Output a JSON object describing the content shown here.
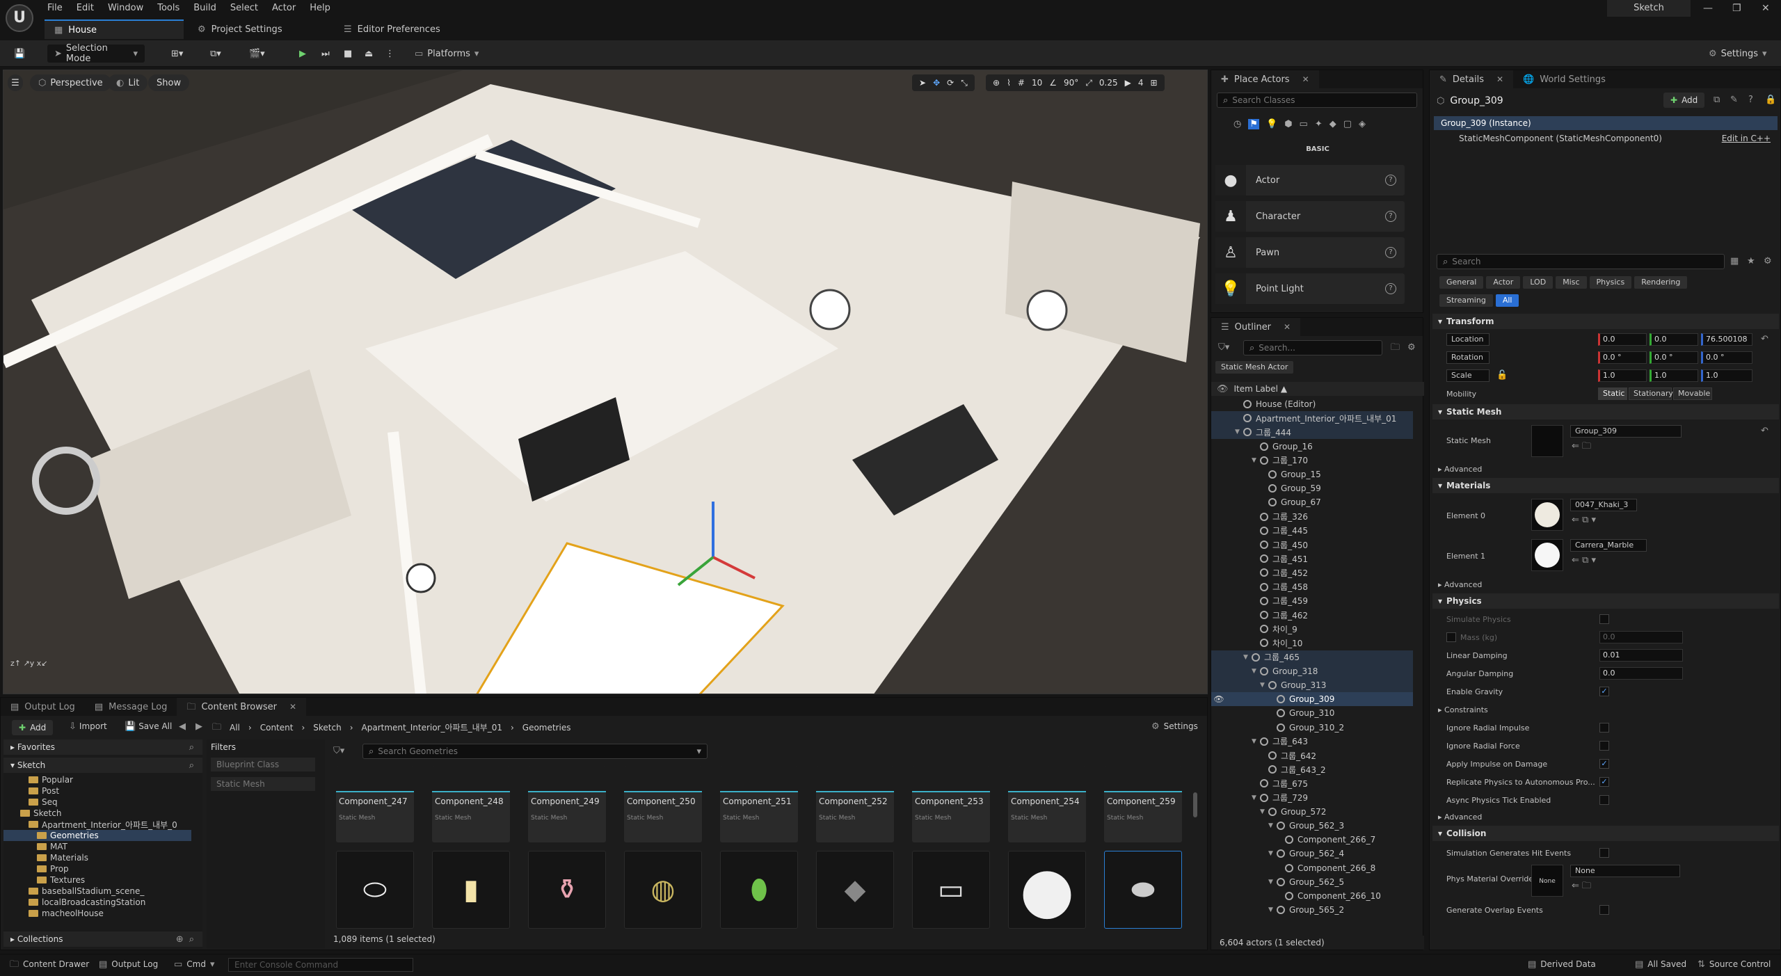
{
  "menu": [
    "File",
    "Edit",
    "Window",
    "Tools",
    "Build",
    "Select",
    "Actor",
    "Help"
  ],
  "tabs": {
    "level": "House",
    "project_settings": "Project Settings",
    "editor_prefs": "Editor Preferences"
  },
  "project_name": "Sketch",
  "toolbar": {
    "selection_mode": "Selection Mode",
    "platforms": "Platforms",
    "settings": "Settings"
  },
  "viewport": {
    "perspective": "Perspective",
    "lit": "Lit",
    "show": "Show",
    "grid": "10",
    "angle": "90°",
    "scale": "0.25",
    "camera_speed": "4"
  },
  "place_actors": {
    "tab": "Place Actors",
    "search_placeholder": "Search Classes",
    "category": "BASIC",
    "items": [
      "Actor",
      "Character",
      "Pawn",
      "Point Light"
    ]
  },
  "outliner": {
    "tab": "Outliner",
    "search_placeholder": "Search...",
    "filter_chip": "Static Mesh Actor",
    "column": "Item Label ▲",
    "rows": [
      {
        "label": "House (Editor)",
        "indent": 1,
        "tri": ""
      },
      {
        "label": "Apartment_Interior_아파트_내부_01",
        "indent": 1,
        "tri": ""
      },
      {
        "label": "그룹_444",
        "indent": 1,
        "tri": "▼"
      },
      {
        "label": "Group_16",
        "indent": 3,
        "tri": ""
      },
      {
        "label": "그룹_170",
        "indent": 3,
        "tri": "▼"
      },
      {
        "label": "Group_15",
        "indent": 4,
        "tri": ""
      },
      {
        "label": "Group_59",
        "indent": 4,
        "tri": ""
      },
      {
        "label": "Group_67",
        "indent": 4,
        "tri": ""
      },
      {
        "label": "그룹_326",
        "indent": 3,
        "tri": ""
      },
      {
        "label": "그룹_445",
        "indent": 3,
        "tri": ""
      },
      {
        "label": "그룹_450",
        "indent": 3,
        "tri": ""
      },
      {
        "label": "그룹_451",
        "indent": 3,
        "tri": ""
      },
      {
        "label": "그룹_452",
        "indent": 3,
        "tri": ""
      },
      {
        "label": "그룹_458",
        "indent": 3,
        "tri": ""
      },
      {
        "label": "그룹_459",
        "indent": 3,
        "tri": ""
      },
      {
        "label": "그룹_462",
        "indent": 3,
        "tri": ""
      },
      {
        "label": "차이_9",
        "indent": 3,
        "tri": ""
      },
      {
        "label": "차이_10",
        "indent": 3,
        "tri": ""
      },
      {
        "label": "그룹_465",
        "indent": 2,
        "tri": "▼"
      },
      {
        "label": "Group_318",
        "indent": 3,
        "tri": "▼"
      },
      {
        "label": "Group_313",
        "indent": 4,
        "tri": "▼"
      },
      {
        "label": "Group_309",
        "indent": 5,
        "tri": ""
      },
      {
        "label": "Group_310",
        "indent": 5,
        "tri": ""
      },
      {
        "label": "Group_310_2",
        "indent": 5,
        "tri": ""
      },
      {
        "label": "그룹_643",
        "indent": 3,
        "tri": "▼"
      },
      {
        "label": "그룹_642",
        "indent": 4,
        "tri": ""
      },
      {
        "label": "그룹_643_2",
        "indent": 4,
        "tri": ""
      },
      {
        "label": "그룹_675",
        "indent": 3,
        "tri": ""
      },
      {
        "label": "그룹_729",
        "indent": 3,
        "tri": "▼"
      },
      {
        "label": "Group_572",
        "indent": 4,
        "tri": "▼"
      },
      {
        "label": "Group_562_3",
        "indent": 5,
        "tri": "▼"
      },
      {
        "label": "Component_266_7",
        "indent": 6,
        "tri": ""
      },
      {
        "label": "Group_562_4",
        "indent": 5,
        "tri": "▼"
      },
      {
        "label": "Component_266_8",
        "indent": 6,
        "tri": ""
      },
      {
        "label": "Group_562_5",
        "indent": 5,
        "tri": "▼"
      },
      {
        "label": "Component_266_10",
        "indent": 6,
        "tri": ""
      },
      {
        "label": "Group_565_2",
        "indent": 5,
        "tri": "▼"
      }
    ],
    "footer": "6,604 actors (1 selected)"
  },
  "details": {
    "tab": "Details",
    "world_tab": "World Settings",
    "actor_name": "Group_309",
    "add": "Add",
    "instance": "Group_309 (Instance)",
    "component": "StaticMeshComponent (StaticMeshComponent0)",
    "edit_cpp": "Edit in C++",
    "search_placeholder": "Search",
    "filters_row1": [
      "General",
      "Actor",
      "LOD",
      "Misc",
      "Physics",
      "Rendering"
    ],
    "filters_row2": [
      "Streaming",
      "All"
    ],
    "transform": {
      "title": "Transform",
      "location": {
        "label": "Location",
        "x": "0.0",
        "y": "0.0",
        "z": "76.500108"
      },
      "rotation": {
        "label": "Rotation",
        "x": "0.0 °",
        "y": "0.0 °",
        "z": "0.0 °"
      },
      "scale": {
        "label": "Scale",
        "x": "1.0",
        "y": "1.0",
        "z": "1.0"
      },
      "mobility": {
        "label": "Mobility",
        "options": [
          "Static",
          "Stationary",
          "Movable"
        ]
      }
    },
    "static_mesh": {
      "title": "Static Mesh",
      "label": "Static Mesh",
      "value": "Group_309"
    },
    "advanced": "Advanced",
    "materials": {
      "title": "Materials",
      "el0_label": "Element 0",
      "el0": "0047_Khaki_3",
      "el1_label": "Element 1",
      "el1": "Carrera_Marble"
    },
    "physics": {
      "title": "Physics",
      "simulate": "Simulate Physics",
      "mass": "Mass (kg)",
      "mass_val": "0.0",
      "linear": "Linear Damping",
      "linear_val": "0.01",
      "angular": "Angular Damping",
      "angular_val": "0.0",
      "gravity": "Enable Gravity",
      "constraints": "Constraints",
      "ign_impulse": "Ignore Radial Impulse",
      "ign_force": "Ignore Radial Force",
      "apply_impulse": "Apply Impulse on Damage",
      "replicate": "Replicate Physics to Autonomous Pro...",
      "async": "Async Physics Tick Enabled"
    },
    "collision": {
      "title": "Collision",
      "hit": "Simulation Generates Hit Events",
      "phys_mat": "Phys Material Override",
      "phys_mat_val": "None",
      "none_thumb": "None",
      "overlap": "Generate Overlap Events"
    }
  },
  "bottom_tabs": {
    "output_log": "Output Log",
    "message_log": "Message Log",
    "content_browser": "Content Browser"
  },
  "content_browser": {
    "add": "Add",
    "import": "Import",
    "save_all": "Save All",
    "path": [
      "All",
      "Content",
      "Sketch",
      "Apartment_Interior_아파트_내부_01",
      "Geometries"
    ],
    "settings": "Settings",
    "favorites": "Favorites",
    "root": "Sketch",
    "tree": [
      {
        "label": "Popular",
        "indent": 3
      },
      {
        "label": "Post",
        "indent": 3
      },
      {
        "label": "Seq",
        "indent": 3
      },
      {
        "label": "Sketch",
        "indent": 2
      },
      {
        "label": "Apartment_Interior_아파트_내부_0",
        "indent": 3
      },
      {
        "label": "Geometries",
        "indent": 4
      },
      {
        "label": "MAT",
        "indent": 4
      },
      {
        "label": "Materials",
        "indent": 4
      },
      {
        "label": "Prop",
        "indent": 4
      },
      {
        "label": "Textures",
        "indent": 4
      },
      {
        "label": "baseballStadium_scene_",
        "indent": 3
      },
      {
        "label": "localBroadcastingStation",
        "indent": 3
      },
      {
        "label": "macheolHouse",
        "indent": 3
      }
    ],
    "collections": "Collections",
    "filters_title": "Filters",
    "filters": [
      "Blueprint Class",
      "Static Mesh"
    ],
    "search_placeholder": "Search Geometries",
    "assets": [
      "Component_247",
      "Component_248",
      "Component_249",
      "Component_250",
      "Component_251",
      "Component_252",
      "Component_253",
      "Component_254",
      "Component_259"
    ],
    "asset_type": "Static Mesh",
    "count": "1,089 items (1 selected)"
  },
  "statusbar": {
    "drawer": "Content Drawer",
    "output": "Output Log",
    "cmd": "Cmd",
    "console_placeholder": "Enter Console Command",
    "derived": "Derived Data",
    "saved": "All Saved",
    "source": "Source Control"
  }
}
